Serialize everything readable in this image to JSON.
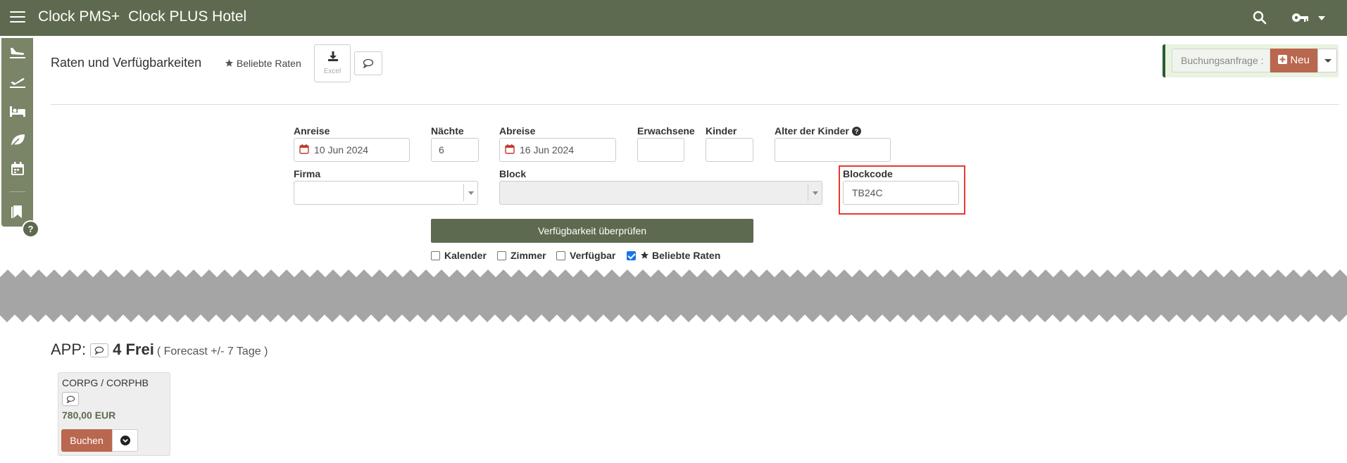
{
  "topbar": {
    "app_name": "Clock PMS+",
    "hotel_name": "Clock PLUS Hotel",
    "icons": [
      "menu-icon",
      "search-icon",
      "key-icon",
      "caret-down-icon"
    ]
  },
  "sidebar": {
    "icons": [
      "plane-arrival-icon",
      "plane-departure-icon",
      "bed-icon",
      "leaf-icon",
      "calendar-icon",
      "bookmark-icon"
    ],
    "help": "?"
  },
  "header": {
    "title": "Raten und Verfügbarkeiten",
    "favorites_link": "Beliebte Raten",
    "excel_label": "Excel"
  },
  "booking_request": {
    "label": "Buchungsanfrage :",
    "new_label": "Neu"
  },
  "form": {
    "arrival_label": "Anreise",
    "arrival_value": "10 Jun 2024",
    "nights_label": "Nächte",
    "nights_value": "6",
    "departure_label": "Abreise",
    "departure_value": "16 Jun 2024",
    "adults_label": "Erwachsene",
    "adults_value": "",
    "children_label": "Kinder",
    "children_value": "",
    "children_age_label": "Alter der Kinder",
    "children_age_value": "",
    "company_label": "Firma",
    "company_value": "",
    "block_label": "Block",
    "block_value": "",
    "blockcode_label": "Blockcode",
    "blockcode_value": "TB24C",
    "check_button": "Verfügbarkeit überprüfen"
  },
  "options": [
    {
      "label": "Kalender",
      "checked": false
    },
    {
      "label": "Zimmer",
      "checked": false
    },
    {
      "label": "Verfügbar",
      "checked": false
    },
    {
      "label": "Beliebte Raten",
      "checked": true
    }
  ],
  "results": {
    "room_type": "APP:",
    "free": "4 Frei",
    "forecast": "( Forecast +/- 7 Tage )",
    "rate": {
      "name": "CORPG / CORPHB",
      "price": "780,00 EUR",
      "book_button": "Buchen"
    }
  },
  "colors": {
    "topbar": "#5e6a4f",
    "accent_button": "#b9674f",
    "highlight_frame": "#e53935",
    "checkbox_checked": "#1a73e8"
  }
}
